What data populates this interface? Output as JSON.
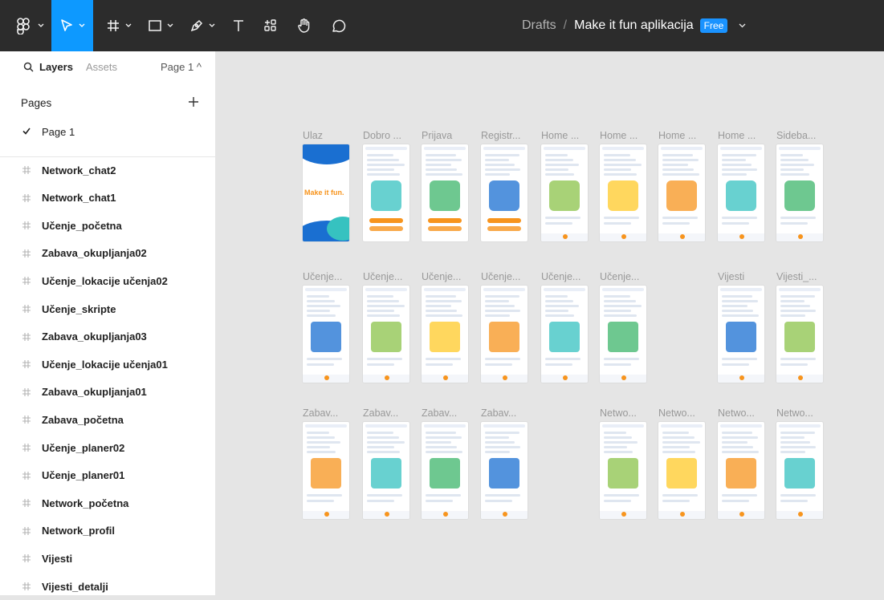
{
  "toolbar": {
    "tools": [
      {
        "name": "main-menu",
        "icon": "figma-grid-icon",
        "has_chevron": true
      },
      {
        "name": "move-tool",
        "icon": "pointer-icon",
        "has_chevron": true,
        "active": true
      },
      {
        "name": "frame-tool",
        "icon": "hash-frame-icon",
        "has_chevron": true
      },
      {
        "name": "shape-tool",
        "icon": "rectangle-icon",
        "has_chevron": true
      },
      {
        "name": "pen-tool",
        "icon": "pen-icon",
        "has_chevron": true
      },
      {
        "name": "text-tool",
        "icon": "text-icon",
        "has_chevron": false
      },
      {
        "name": "resources-tool",
        "icon": "components-icon",
        "has_chevron": false
      },
      {
        "name": "hand-tool",
        "icon": "hand-icon",
        "has_chevron": false
      },
      {
        "name": "comment-tool",
        "icon": "comment-icon",
        "has_chevron": false
      }
    ],
    "colors": {
      "bar": "#2c2c2c",
      "active": "#0d99ff",
      "badge": "#1a93ff"
    }
  },
  "file": {
    "location": "Drafts",
    "separator": "/",
    "name": "Make it fun aplikacija",
    "plan_badge": "Free"
  },
  "sidebar": {
    "tabs": {
      "layers": "Layers",
      "assets": "Assets"
    },
    "page_selector": "Page 1 ^",
    "pages_heading": "Pages",
    "pages": [
      {
        "label": "Page 1",
        "selected": true
      }
    ],
    "layers": [
      "Network_chat2",
      "Network_chat1",
      "Učenje_početna",
      "Zabava_okupljanja02",
      "Učenje_lokacije učenja02",
      "Učenje_skripte",
      "Zabava_okupljanja03",
      "Učenje_lokacije učenja01",
      "Zabava_okupljanja01",
      "Zabava_početna",
      "Učenje_planer02",
      "Učenje_planer01",
      "Network_početna",
      "Network_profil",
      "Vijesti",
      "Vijesti_detalji"
    ]
  },
  "canvas": {
    "row1": [
      "Ulaz",
      "Dobro ...",
      "Prijava",
      "Registr...",
      "Home ...",
      "Home ...",
      "Home ...",
      "Home ...",
      "Sideba..."
    ],
    "row2": [
      "Učenje...",
      "Učenje...",
      "Učenje...",
      "Učenje...",
      "Učenje...",
      "Učenje...",
      "Vijesti",
      "Vijesti_..."
    ],
    "row3": [
      "Zabav...",
      "Zabav...",
      "Zabav...",
      "Zabav...",
      "Netwo...",
      "Netwo...",
      "Netwo...",
      "Netwo..."
    ],
    "splash_text": "Make it fun.",
    "accent_colors": {
      "orange": "#f7941d",
      "blue": "#1a6fd1",
      "green": "#3db56b",
      "teal": "#36c2c0"
    }
  }
}
